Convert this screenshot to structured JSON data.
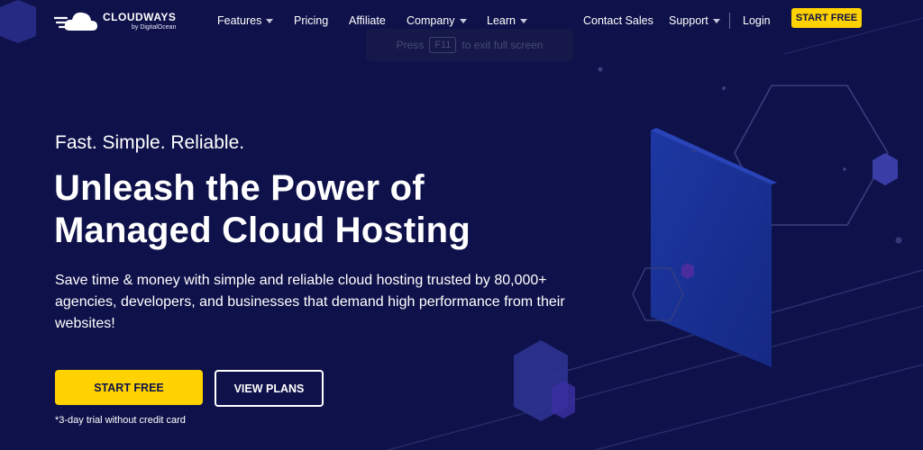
{
  "brand": {
    "name": "CLOUDWAYS",
    "sub": "by DigitalOcean"
  },
  "nav": {
    "items": [
      {
        "label": "Features",
        "dropdown": true
      },
      {
        "label": "Pricing",
        "dropdown": false
      },
      {
        "label": "Affiliate",
        "dropdown": false
      },
      {
        "label": "Company",
        "dropdown": true
      },
      {
        "label": "Learn",
        "dropdown": true
      }
    ],
    "contact_sales": "Contact Sales",
    "support": "Support",
    "login": "Login",
    "cta": "START FREE"
  },
  "fullscreen_hint": {
    "before": "Press",
    "key": "F11",
    "after": "to exit full screen"
  },
  "hero": {
    "tagline": "Fast. Simple. Reliable.",
    "headline_line1": "Unleash the Power of",
    "headline_line2": "Managed Cloud Hosting",
    "description": "Save time & money with simple and reliable cloud hosting trusted by 80,000+ agencies, developers, and businesses that demand high performance from their websites!",
    "primary_button": "START FREE",
    "secondary_button": "VIEW PLANS",
    "trial_note": "*3-day trial without credit card"
  },
  "colors": {
    "background": "#0f124a",
    "accent": "#ffd200",
    "text": "#ffffff"
  }
}
